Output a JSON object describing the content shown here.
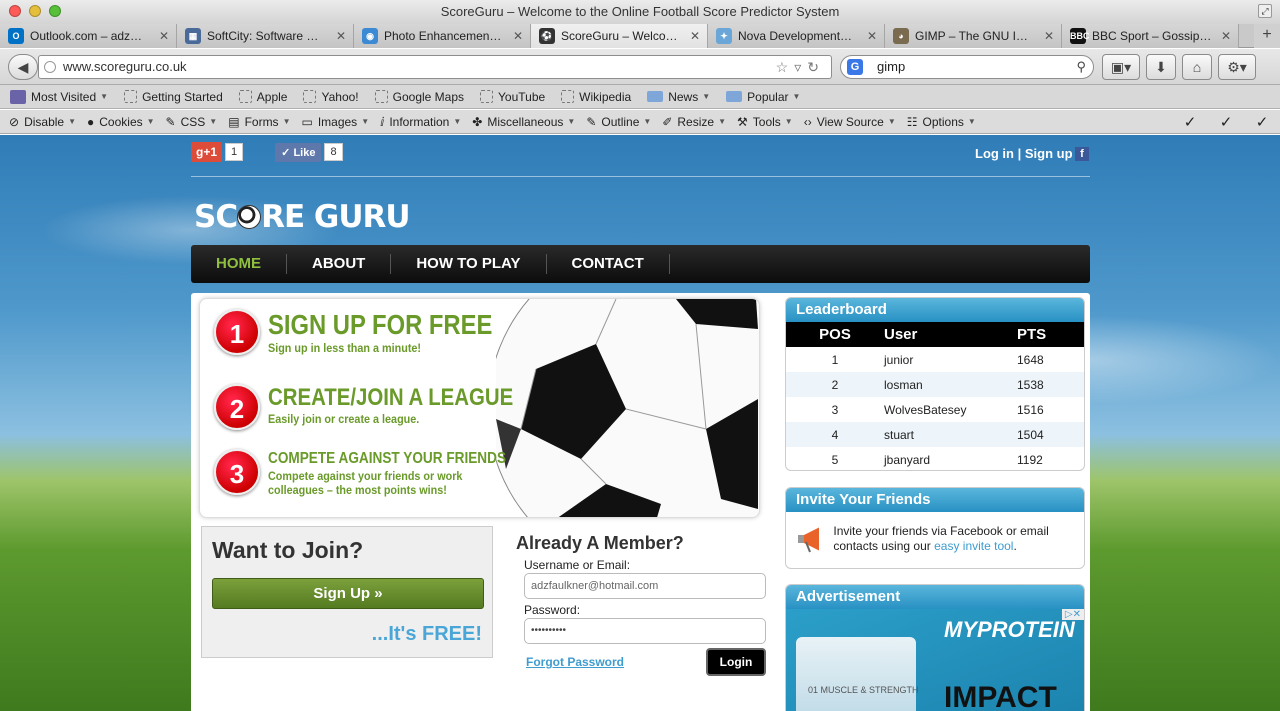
{
  "window": {
    "title": "ScoreGuru – Welcome to the Online Football Score Predictor System"
  },
  "tabs": [
    {
      "label": "Outlook.com – adz…",
      "icon": "outlook-icon",
      "color": "#0072c6"
    },
    {
      "label": "SoftCity: Software …",
      "icon": "softcity-icon",
      "color": "#4a6b9a"
    },
    {
      "label": "Photo Enhancemen…",
      "icon": "photo-enhancement-icon",
      "color": "#3d8ad4"
    },
    {
      "label": "ScoreGuru – Welco…",
      "icon": "football-icon",
      "color": "#333333",
      "active": true
    },
    {
      "label": "Nova Development…",
      "icon": "nova-icon",
      "color": "#6aa7d8"
    },
    {
      "label": "GIMP – The GNU I…",
      "icon": "gimp-icon",
      "color": "#7a6a4f"
    },
    {
      "label": "BBC Sport – Gossip…",
      "icon": "bbc-icon",
      "color": "#111111"
    }
  ],
  "toolbar": {
    "url": "www.scoreguru.co.uk",
    "search_value": "gimp",
    "search_engine": "G"
  },
  "bookmarks": [
    {
      "label": "Most Visited",
      "type": "most-visited",
      "dropdown": true
    },
    {
      "label": "Getting Started",
      "type": "page"
    },
    {
      "label": "Apple",
      "type": "page"
    },
    {
      "label": "Yahoo!",
      "type": "page"
    },
    {
      "label": "Google Maps",
      "type": "page"
    },
    {
      "label": "YouTube",
      "type": "page"
    },
    {
      "label": "Wikipedia",
      "type": "page"
    },
    {
      "label": "News",
      "type": "folder",
      "dropdown": true
    },
    {
      "label": "Popular",
      "type": "folder",
      "dropdown": true
    }
  ],
  "devtools": [
    {
      "label": "Disable",
      "icon": "disable-icon"
    },
    {
      "label": "Cookies",
      "icon": "cookies-icon"
    },
    {
      "label": "CSS",
      "icon": "css-icon"
    },
    {
      "label": "Forms",
      "icon": "forms-icon"
    },
    {
      "label": "Images",
      "icon": "images-icon"
    },
    {
      "label": "Information",
      "icon": "information-icon"
    },
    {
      "label": "Miscellaneous",
      "icon": "miscellaneous-icon"
    },
    {
      "label": "Outline",
      "icon": "outline-icon"
    },
    {
      "label": "Resize",
      "icon": "resize-icon"
    },
    {
      "label": "Tools",
      "icon": "tools-icon"
    },
    {
      "label": "View Source",
      "icon": "view-source-icon"
    },
    {
      "label": "Options",
      "icon": "options-icon"
    }
  ],
  "social": {
    "gplus_label": "+1",
    "gplus_count": "1",
    "like_label": "Like",
    "like_count": "8"
  },
  "header": {
    "login_text": "Log in | Sign up",
    "logo": "SC",
    "logo_rest": "RE GURU"
  },
  "nav": [
    {
      "label": "HOME",
      "active": true
    },
    {
      "label": "ABOUT"
    },
    {
      "label": "HOW TO PLAY"
    },
    {
      "label": "CONTACT"
    }
  ],
  "promo": {
    "steps": [
      {
        "num": "1",
        "title": "SIGN UP FOR FREE",
        "sub": "Sign up in less than a minute!"
      },
      {
        "num": "2",
        "title": "CREATE/JOIN A LEAGUE",
        "sub": "Easily join or create a league."
      },
      {
        "num": "3",
        "title": "COMPETE AGAINST YOUR FRIENDS",
        "sub": "Compete against your friends or work colleagues – the most points wins!"
      }
    ]
  },
  "join": {
    "title": "Want to Join?",
    "button": "Sign Up »",
    "free": "...It's FREE!"
  },
  "member": {
    "title": "Already A Member?",
    "username_label": "Username or Email:",
    "username_value": "adzfaulkner@hotmail.com",
    "password_label": "Password:",
    "password_value": "••••••••••",
    "forgot": "Forgot Password",
    "login": "Login"
  },
  "leaderboard": {
    "title": "Leaderboard",
    "headers": [
      "POS",
      "User",
      "PTS"
    ],
    "rows": [
      {
        "pos": "1",
        "user": "junior",
        "pts": "1648"
      },
      {
        "pos": "2",
        "user": "losman",
        "pts": "1538"
      },
      {
        "pos": "3",
        "user": "WolvesBatesey",
        "pts": "1516"
      },
      {
        "pos": "4",
        "user": "stuart",
        "pts": "1504"
      },
      {
        "pos": "5",
        "user": "jbanyard",
        "pts": "1192"
      }
    ]
  },
  "invite": {
    "title": "Invite Your Friends",
    "text": "Invite your friends via Facebook or email contacts using our ",
    "link": "easy invite tool",
    "end": "."
  },
  "ad": {
    "title": "Advertisement",
    "brand": "MYPROTEIN",
    "headline": "IMPACT",
    "tub_text": "01 MUSCLE & STRENGTH"
  }
}
